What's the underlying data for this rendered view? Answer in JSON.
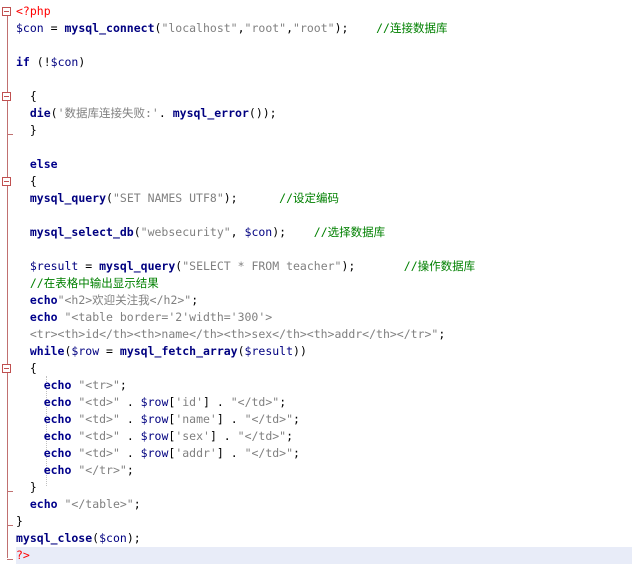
{
  "editor": {
    "language": "php",
    "lines": [
      {
        "segments": [
          [
            "tag",
            "<?php"
          ]
        ]
      },
      {
        "segments": [
          [
            "var",
            "$con"
          ],
          [
            "op",
            " = "
          ],
          [
            "fn",
            "mysql_connect"
          ],
          [
            "op",
            "("
          ],
          [
            "str",
            "\"localhost\""
          ],
          [
            "op",
            ","
          ],
          [
            "str",
            "\"root\""
          ],
          [
            "op",
            ","
          ],
          [
            "str",
            "\"root\""
          ],
          [
            "op",
            ");    "
          ],
          [
            "cm",
            "//连接数据库"
          ]
        ]
      },
      {
        "segments": []
      },
      {
        "segments": [
          [
            "kw",
            "if"
          ],
          [
            "op",
            " (!"
          ],
          [
            "var",
            "$con"
          ],
          [
            "op",
            ")"
          ]
        ]
      },
      {
        "segments": []
      },
      {
        "segments": [
          [
            "op",
            "  {"
          ]
        ]
      },
      {
        "segments": [
          [
            "op",
            "  "
          ],
          [
            "fn",
            "die"
          ],
          [
            "op",
            "("
          ],
          [
            "str",
            "'数据库连接失败:'"
          ],
          [
            "op",
            ". "
          ],
          [
            "fn",
            "mysql_error"
          ],
          [
            "op",
            "());"
          ]
        ]
      },
      {
        "segments": [
          [
            "op",
            "  }"
          ]
        ]
      },
      {
        "segments": []
      },
      {
        "segments": [
          [
            "kw",
            "  else"
          ]
        ]
      },
      {
        "segments": [
          [
            "op",
            "  {"
          ]
        ]
      },
      {
        "segments": [
          [
            "op",
            "  "
          ],
          [
            "fn",
            "mysql_query"
          ],
          [
            "op",
            "("
          ],
          [
            "str",
            "\"SET NAMES UTF8\""
          ],
          [
            "op",
            ");      "
          ],
          [
            "cm",
            "//设定编码"
          ]
        ]
      },
      {
        "segments": []
      },
      {
        "segments": [
          [
            "op",
            "  "
          ],
          [
            "fn",
            "mysql_select_db"
          ],
          [
            "op",
            "("
          ],
          [
            "str",
            "\"websecurity\""
          ],
          [
            "op",
            ", "
          ],
          [
            "var",
            "$con"
          ],
          [
            "op",
            ");    "
          ],
          [
            "cm",
            "//选择数据库"
          ]
        ]
      },
      {
        "segments": []
      },
      {
        "segments": [
          [
            "op",
            "  "
          ],
          [
            "var",
            "$result"
          ],
          [
            "op",
            " = "
          ],
          [
            "fn",
            "mysql_query"
          ],
          [
            "op",
            "("
          ],
          [
            "str",
            "\"SELECT * FROM teacher\""
          ],
          [
            "op",
            ");       "
          ],
          [
            "cm",
            "//操作数据库"
          ]
        ]
      },
      {
        "segments": [
          [
            "op",
            "  "
          ],
          [
            "cm",
            "//在表格中输出显示结果"
          ]
        ]
      },
      {
        "segments": [
          [
            "op",
            "  "
          ],
          [
            "kw",
            "echo"
          ],
          [
            "str",
            "\"<h2>欢迎关注我</h2>\""
          ],
          [
            "op",
            ";"
          ]
        ]
      },
      {
        "segments": [
          [
            "op",
            "  "
          ],
          [
            "kw",
            "echo"
          ],
          [
            "op",
            " "
          ],
          [
            "str",
            "\"<table border='2'width='300'>"
          ]
        ]
      },
      {
        "segments": [
          [
            "str",
            "  <tr><th>id</th><th>name</th><th>sex</th><th>addr</th></tr>\""
          ],
          [
            "op",
            ";"
          ]
        ]
      },
      {
        "segments": [
          [
            "op",
            "  "
          ],
          [
            "kw",
            "while"
          ],
          [
            "op",
            "("
          ],
          [
            "var",
            "$row"
          ],
          [
            "op",
            " = "
          ],
          [
            "fn",
            "mysql_fetch_array"
          ],
          [
            "op",
            "("
          ],
          [
            "var",
            "$result"
          ],
          [
            "op",
            "))"
          ]
        ]
      },
      {
        "segments": [
          [
            "op",
            "  {"
          ]
        ]
      },
      {
        "segments": [
          [
            "op",
            "    "
          ],
          [
            "kw",
            "echo"
          ],
          [
            "op",
            " "
          ],
          [
            "str",
            "\"<tr>\""
          ],
          [
            "op",
            ";"
          ]
        ]
      },
      {
        "segments": [
          [
            "op",
            "    "
          ],
          [
            "kw",
            "echo"
          ],
          [
            "op",
            " "
          ],
          [
            "str",
            "\"<td>\""
          ],
          [
            "op",
            " . "
          ],
          [
            "var",
            "$row"
          ],
          [
            "op",
            "["
          ],
          [
            "str",
            "'id'"
          ],
          [
            "op",
            "] . "
          ],
          [
            "str",
            "\"</td>\""
          ],
          [
            "op",
            ";"
          ]
        ]
      },
      {
        "segments": [
          [
            "op",
            "    "
          ],
          [
            "kw",
            "echo"
          ],
          [
            "op",
            " "
          ],
          [
            "str",
            "\"<td>\""
          ],
          [
            "op",
            " . "
          ],
          [
            "var",
            "$row"
          ],
          [
            "op",
            "["
          ],
          [
            "str",
            "'name'"
          ],
          [
            "op",
            "] . "
          ],
          [
            "str",
            "\"</td>\""
          ],
          [
            "op",
            ";"
          ]
        ]
      },
      {
        "segments": [
          [
            "op",
            "    "
          ],
          [
            "kw",
            "echo"
          ],
          [
            "op",
            " "
          ],
          [
            "str",
            "\"<td>\""
          ],
          [
            "op",
            " . "
          ],
          [
            "var",
            "$row"
          ],
          [
            "op",
            "["
          ],
          [
            "str",
            "'sex'"
          ],
          [
            "op",
            "] . "
          ],
          [
            "str",
            "\"</td>\""
          ],
          [
            "op",
            ";"
          ]
        ]
      },
      {
        "segments": [
          [
            "op",
            "    "
          ],
          [
            "kw",
            "echo"
          ],
          [
            "op",
            " "
          ],
          [
            "str",
            "\"<td>\""
          ],
          [
            "op",
            " . "
          ],
          [
            "var",
            "$row"
          ],
          [
            "op",
            "["
          ],
          [
            "str",
            "'addr'"
          ],
          [
            "op",
            "] . "
          ],
          [
            "str",
            "\"</td>\""
          ],
          [
            "op",
            ";"
          ]
        ]
      },
      {
        "segments": [
          [
            "op",
            "    "
          ],
          [
            "kw",
            "echo"
          ],
          [
            "op",
            " "
          ],
          [
            "str",
            "\"</tr>\""
          ],
          [
            "op",
            ";"
          ]
        ]
      },
      {
        "segments": [
          [
            "op",
            "  }"
          ]
        ]
      },
      {
        "segments": [
          [
            "op",
            "  "
          ],
          [
            "kw",
            "echo"
          ],
          [
            "op",
            " "
          ],
          [
            "str",
            "\"</table>\""
          ],
          [
            "op",
            ";"
          ]
        ]
      },
      {
        "segments": [
          [
            "op",
            "}"
          ]
        ]
      },
      {
        "segments": [
          [
            "fn",
            "mysql_close"
          ],
          [
            "op",
            "("
          ],
          [
            "var",
            "$con"
          ],
          [
            "op",
            ");"
          ]
        ]
      },
      {
        "segments": [
          [
            "tag",
            "?>"
          ]
        ]
      }
    ]
  }
}
